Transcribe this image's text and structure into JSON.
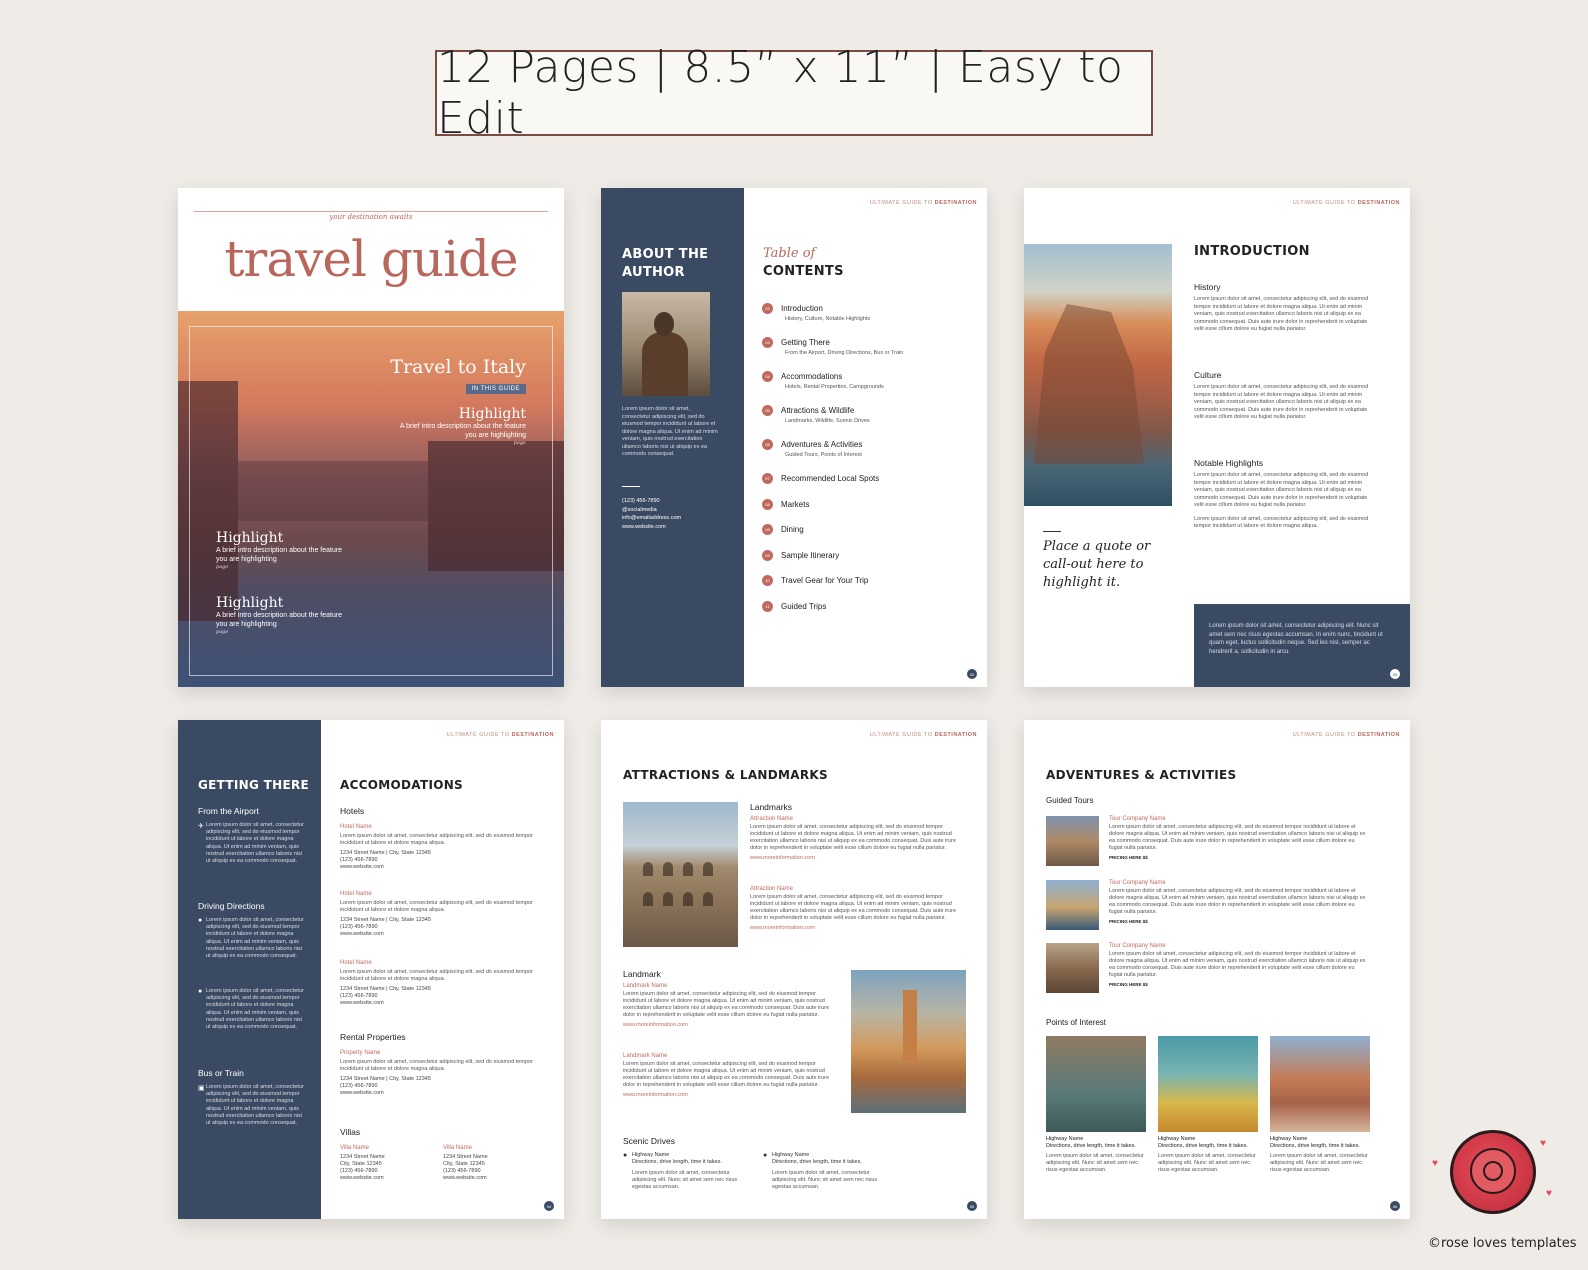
{
  "banner": {
    "text": "12 Pages | 8.5” x 11” | Easy to Edit"
  },
  "header_tag": {
    "prefix": "ULTIMATE GUIDE TO ",
    "bold": "DESTINATION"
  },
  "cover": {
    "tagline": "your destination awaits",
    "title": "travel guide",
    "feature_title": "Travel to Italy",
    "in_this_guide": "IN THIS GUIDE",
    "highlights": [
      {
        "heading": "Highlight",
        "desc": "A brief intro description about the feature you are highlighting",
        "page": "page"
      },
      {
        "heading": "Highlight",
        "desc": "A brief intro description about the feature you are highlighting",
        "page": "page"
      },
      {
        "heading": "Highlight",
        "desc": "A brief intro description about the feature you are highlighting",
        "page": "page"
      }
    ]
  },
  "toc_page": {
    "about_line1": "ABOUT THE",
    "about_line2": "AUTHOR",
    "author_bio": "Lorem ipsum dolor sit amet, consectetur adipiscing elit, sed do eiusmod tempor incididunt ut labore et dolore magna aliqua. Ut enim ad minim veniam, quis nostrud exercitation ullamco laboris nisi ut aliquip ex ea commodo consequat.",
    "contact": [
      "(123) 456-7890",
      "@socialmedia",
      "info@emailaddress.com",
      "www.website.com"
    ],
    "toc_script": "Table of",
    "toc_heading": "CONTENTS",
    "items": [
      {
        "num": "03",
        "title": "Introduction",
        "sub": "History, Culture, Notable Highlights"
      },
      {
        "num": "04",
        "title": "Getting There",
        "sub": "From the Airport, Driving Directions, Bus or Train"
      },
      {
        "num": "04",
        "title": "Accommodations",
        "sub": "Hotels, Rental Properties, Campgrounds"
      },
      {
        "num": "05",
        "title": "Attractions & Wildlife",
        "sub": "Landmarks, Wildlife, Scenic Drives"
      },
      {
        "num": "06",
        "title": "Adventures & Activities",
        "sub": "Guided Tours, Points of Interest"
      },
      {
        "num": "07",
        "title": "Recommended Local Spots",
        "sub": ""
      },
      {
        "num": "08",
        "title": "Markets",
        "sub": ""
      },
      {
        "num": "08",
        "title": "Dining",
        "sub": ""
      },
      {
        "num": "09",
        "title": "Sample Itinerary",
        "sub": ""
      },
      {
        "num": "10",
        "title": "Travel Gear for Your Trip",
        "sub": ""
      },
      {
        "num": "11",
        "title": "Guided Trips",
        "sub": ""
      }
    ],
    "page_num": "02"
  },
  "intro_page": {
    "heading": "INTRODUCTION",
    "sections": [
      {
        "title": "History",
        "text": "Lorem ipsum dolor sit amet, consectetur adipiscing elit, sed do eiusmod tempor incididunt ut labore et dolore magna aliqua. Ut enim ad minim veniam, quis nostrud exercitation ullamco laboris nisi ut aliquip ex ea commodo consequat. Duis aute irure dolor in reprehenderit in voluptate velit esse cillum dolore eu fugiat nulla pariatur."
      },
      {
        "title": "Culture",
        "text": "Lorem ipsum dolor sit amet, consectetur adipiscing elit, sed do eiusmod tempor incididunt ut labore et dolore magna aliqua. Ut enim ad minim veniam, quis nostrud exercitation ullamco laboris nisi ut aliquip ex ea commodo consequat. Duis aute irure dolor in reprehenderit in voluptate velit esse cillum dolore eu fugiat nulla pariatur."
      },
      {
        "title": "Notable Highlights",
        "text": "Lorem ipsum dolor sit amet, consectetur adipiscing elit, sed do eiusmod tempor incididunt ut labore et dolore magna aliqua. Ut enim ad minim veniam, quis nostrud exercitation ullamco laboris nisi ut aliquip ex ea commodo consequat. Duis aute irure dolor in reprehenderit in voluptate velit esse cillum dolore eu fugiat nulla pariatur."
      }
    ],
    "extra_text": "Lorem ipsum dolor sit amet, consectetur adipiscing elit, sed do eiusmod tempor incididunt ut labore et dolore magna aliqua.",
    "quote": "Place a quote or call-out here to highlight it.",
    "callout": "Lorem ipsum dolor sit amet, consectetur adipiscing elit. Nunc sit amet sem nec risus egestas accumsan. In enim nunc, tincidunt ut quam eget, luctus sollicitudin neque. Sed leo nisl, semper ac hendrerit a, sollicitudin in arcu.",
    "page_num": "03"
  },
  "getting_page": {
    "side_heading": "GETTING THERE",
    "from_airport": "From the Airport",
    "driving": "Driving Directions",
    "bus": "Bus or Train",
    "lorem": "Lorem ipsum dolor sit amet, consectetur adipiscing elit, sed do eiusmod tempor incididunt ut labore et dolore magna aliqua. Ut enim ad minim veniam, quis nostrud exercitation ullamco laboris nisi ut aliquip ex ea commodo consequat.",
    "main_heading": "ACCOMODATIONS",
    "hotels": "Hotels",
    "hotel_name": "Hotel Name",
    "entry_text": "Lorem ipsum dolor sit amet, consectetur adipiscing elit, sed do eiusmod tempor incididunt ut labore et dolore magna aliqua.",
    "address": "1234 Street Name | City, State 12345",
    "phone": "(123) 456-7890",
    "web": "www.website.com",
    "rental": "Rental Properties",
    "property_name": "Property Name",
    "villas": "Villas",
    "villa_name": "Villa Name",
    "villa_street": "1234 Street Name",
    "villa_city": "City, State 12345",
    "page_num": "04"
  },
  "attractions_page": {
    "heading": "ATTRACTIONS & LANDMARKS",
    "landmarks": "Landmarks",
    "landmark": "Landmark",
    "attraction_name": "Attraction Name",
    "landmark_name": "Landmark Name",
    "text": "Lorem ipsum dolor sit amet, consectetur adipiscing elit, sed do eiusmod tempor incididunt ut labore et dolore magna aliqua. Ut enim ad minim veniam, quis nostrud exercitation ullamco laboris nisi ut aliquip ex ea commodo consequat. Duis aute irure dolor in reprehenderit in voluptate velit esse cillum dolore eu fugiat nulla pariatur.",
    "link": "www.moreinformation.com",
    "scenic": "Scenic Drives",
    "drive_name": "Highway Name",
    "drive_detail": "Directions, drive length, time it takes.",
    "drive_text": "Lorem ipsum dolor sit amet, consectetur adipiscing elit. Nunc sit amet sem nec risus egestas accumsan.",
    "page_num": "05"
  },
  "adventures_page": {
    "heading": "ADVENTURES & ACTIVITIES",
    "guided": "Guided Tours",
    "tour_name": "Tour Company Name",
    "tour_text": "Lorem ipsum dolor sit amet, consectetur adipiscing elit, sed do eiusmod tempor incididunt ut labore et dolore magna aliqua. Ut enim ad minim veniam, quis nostrud exercitation ullamco laboris nisi ut aliquip ex ea commodo consequat. Duis aute irure dolor in reprehenderit in voluptate velit esse cillum dolore eu fugiat nulla pariatur.",
    "pricing": "PRICING HERE $$",
    "poi": "Points of Interest",
    "poi_name": "Highway Name",
    "poi_detail": "Directions, drive length, time it takes.",
    "poi_text": "Lorem ipsum dolor sit amet, consectetur adipiscing elit. Nunc sit amet sem nec risus egestas accumsan.",
    "page_num": "06"
  },
  "brand": {
    "text": "©rose loves templates"
  },
  "colors": {
    "navy": "#3b4a63",
    "rose": "#b9675d",
    "background": "#efebe6"
  }
}
